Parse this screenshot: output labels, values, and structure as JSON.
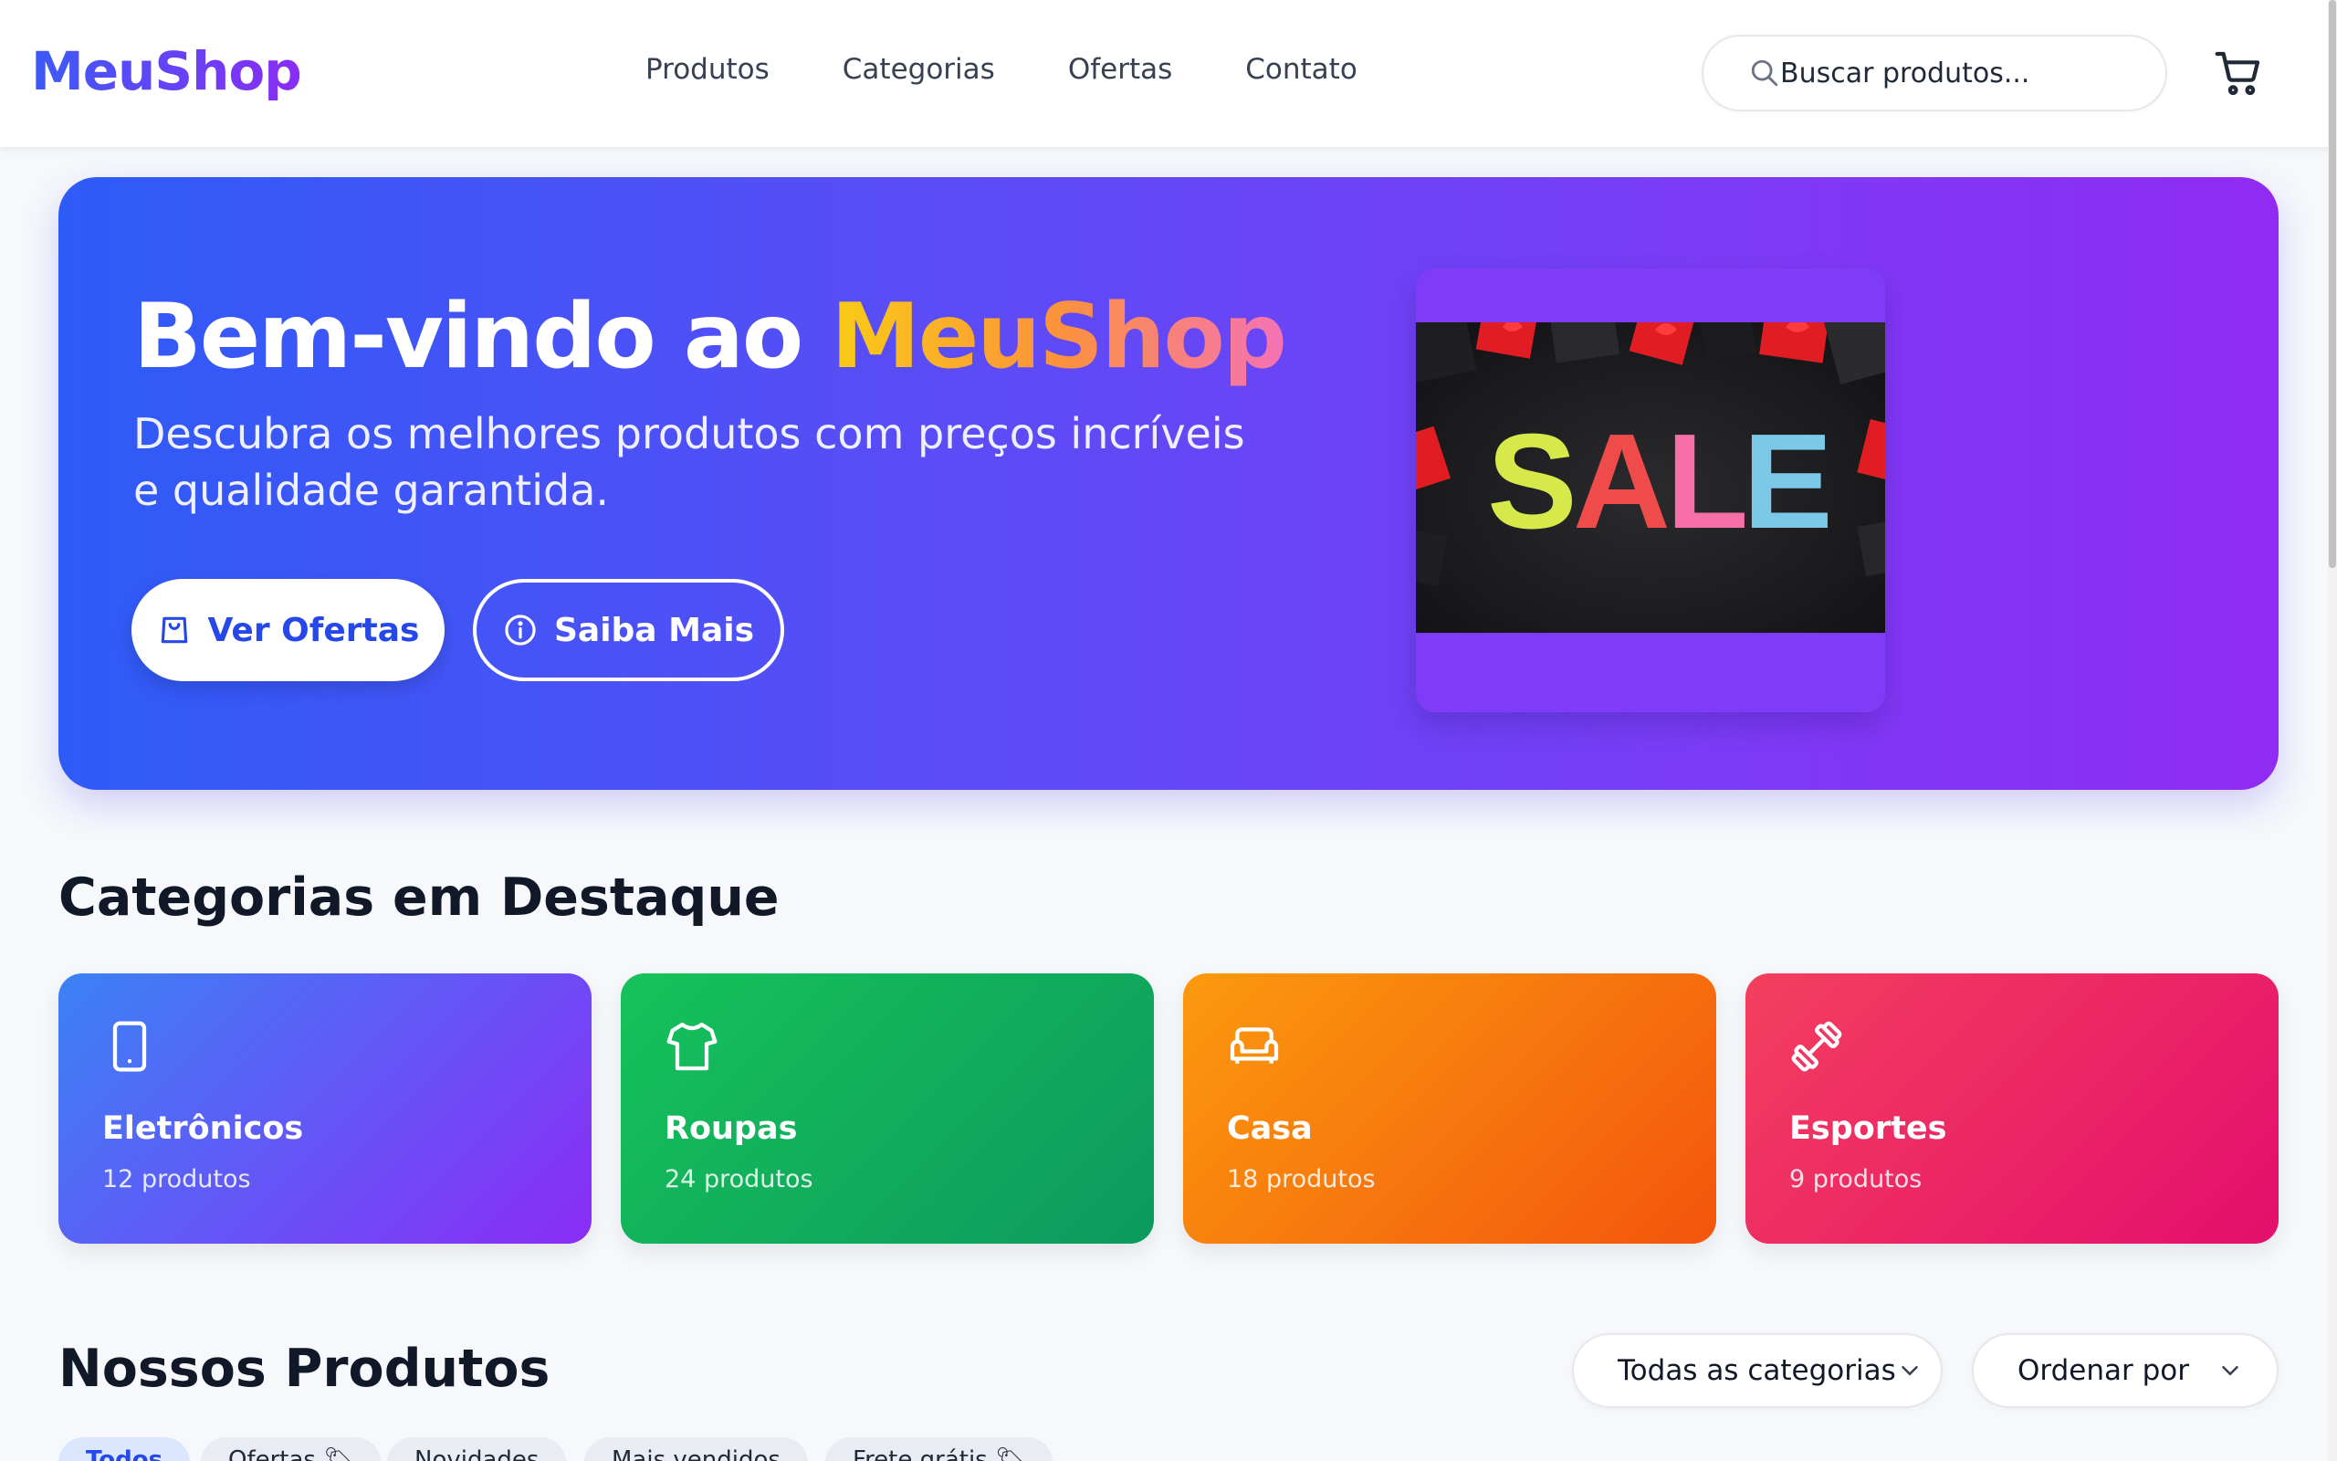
{
  "header": {
    "logo": "MeuShop",
    "nav": [
      "Produtos",
      "Categorias",
      "Ofertas",
      "Contato"
    ],
    "search_placeholder": "Buscar produtos..."
  },
  "hero": {
    "title_prefix": "Bem-vindo ao ",
    "title_brand": "MeuShop",
    "subtitle": "Descubra os melhores produtos com preços incríveis e qualidade garantida.",
    "primary_button": "Ver Ofertas",
    "secondary_button": "Saiba Mais",
    "image_text": "SALE"
  },
  "categories": {
    "title": "Categorias em Destaque",
    "items": [
      {
        "name": "Eletrônicos",
        "count": "12 produtos",
        "icon": "smartphone-icon",
        "colors": [
          "#3b82f6",
          "#8b2cf5"
        ]
      },
      {
        "name": "Roupas",
        "count": "24 produtos",
        "icon": "shirt-icon",
        "colors": [
          "#16c25a",
          "#0c9a5e"
        ]
      },
      {
        "name": "Casa",
        "count": "18 produtos",
        "icon": "sofa-icon",
        "colors": [
          "#fb9a0e",
          "#f3550d"
        ]
      },
      {
        "name": "Esportes",
        "count": "9 produtos",
        "icon": "dumbbell-icon",
        "colors": [
          "#f43f5e",
          "#e30f6c"
        ]
      }
    ]
  },
  "products": {
    "title": "Nossos Produtos",
    "category_select": "Todas as categorias",
    "sort_select": "Ordenar por",
    "filters": [
      "Todos",
      "Ofertas 🏷",
      "Novidades",
      "Mais vendidos",
      "Frete grátis 🏷"
    ]
  },
  "colors": {
    "accent": "#2748e8",
    "hero_start": "#2e5bf7",
    "hero_end": "#8f2bf2"
  }
}
